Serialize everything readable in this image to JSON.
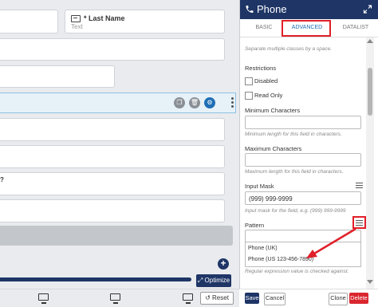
{
  "canvas": {
    "last_name_label": "* Last Name",
    "last_name_placeholder": "Text",
    "question_fragment": "?",
    "optimize_label": "Optimize",
    "reset_label": "Reset"
  },
  "panel": {
    "title": "Phone",
    "tabs": [
      {
        "label": "BASIC",
        "active": false
      },
      {
        "label": "ADVANCED",
        "active": true
      },
      {
        "label": "DATALIST",
        "active": false
      }
    ],
    "css_hint": "Separate multiple classes by a space.",
    "restrictions": {
      "heading": "Restrictions",
      "disabled_label": "Disabled",
      "read_only_label": "Read Only"
    },
    "min_chars": {
      "label": "Minimum Characters",
      "value": "",
      "hint": "Minimum length for this field in characters."
    },
    "max_chars": {
      "label": "Maximum Characters",
      "value": "",
      "hint": "Maximum length for this field in characters."
    },
    "input_mask": {
      "label": "Input Mask",
      "value": "(999) 999-9999",
      "hint": "Input mask for the field, e.g. (999) 999-9999"
    },
    "pattern": {
      "label": "Pattern",
      "value": "",
      "options": [
        "Phone (UK)",
        "Phone (US 123-456-7890)"
      ],
      "hint": "Regular expression value is checked against."
    }
  },
  "footer": {
    "save_label": "Save",
    "cancel_label": "Cancel",
    "clone_label": "Clone",
    "delete_label": "Delete"
  },
  "colors": {
    "header_navy": "#1e3566",
    "accent_blue": "#1f6fb5",
    "annotation_red": "#e0202a",
    "delete_red": "#d9262f"
  }
}
